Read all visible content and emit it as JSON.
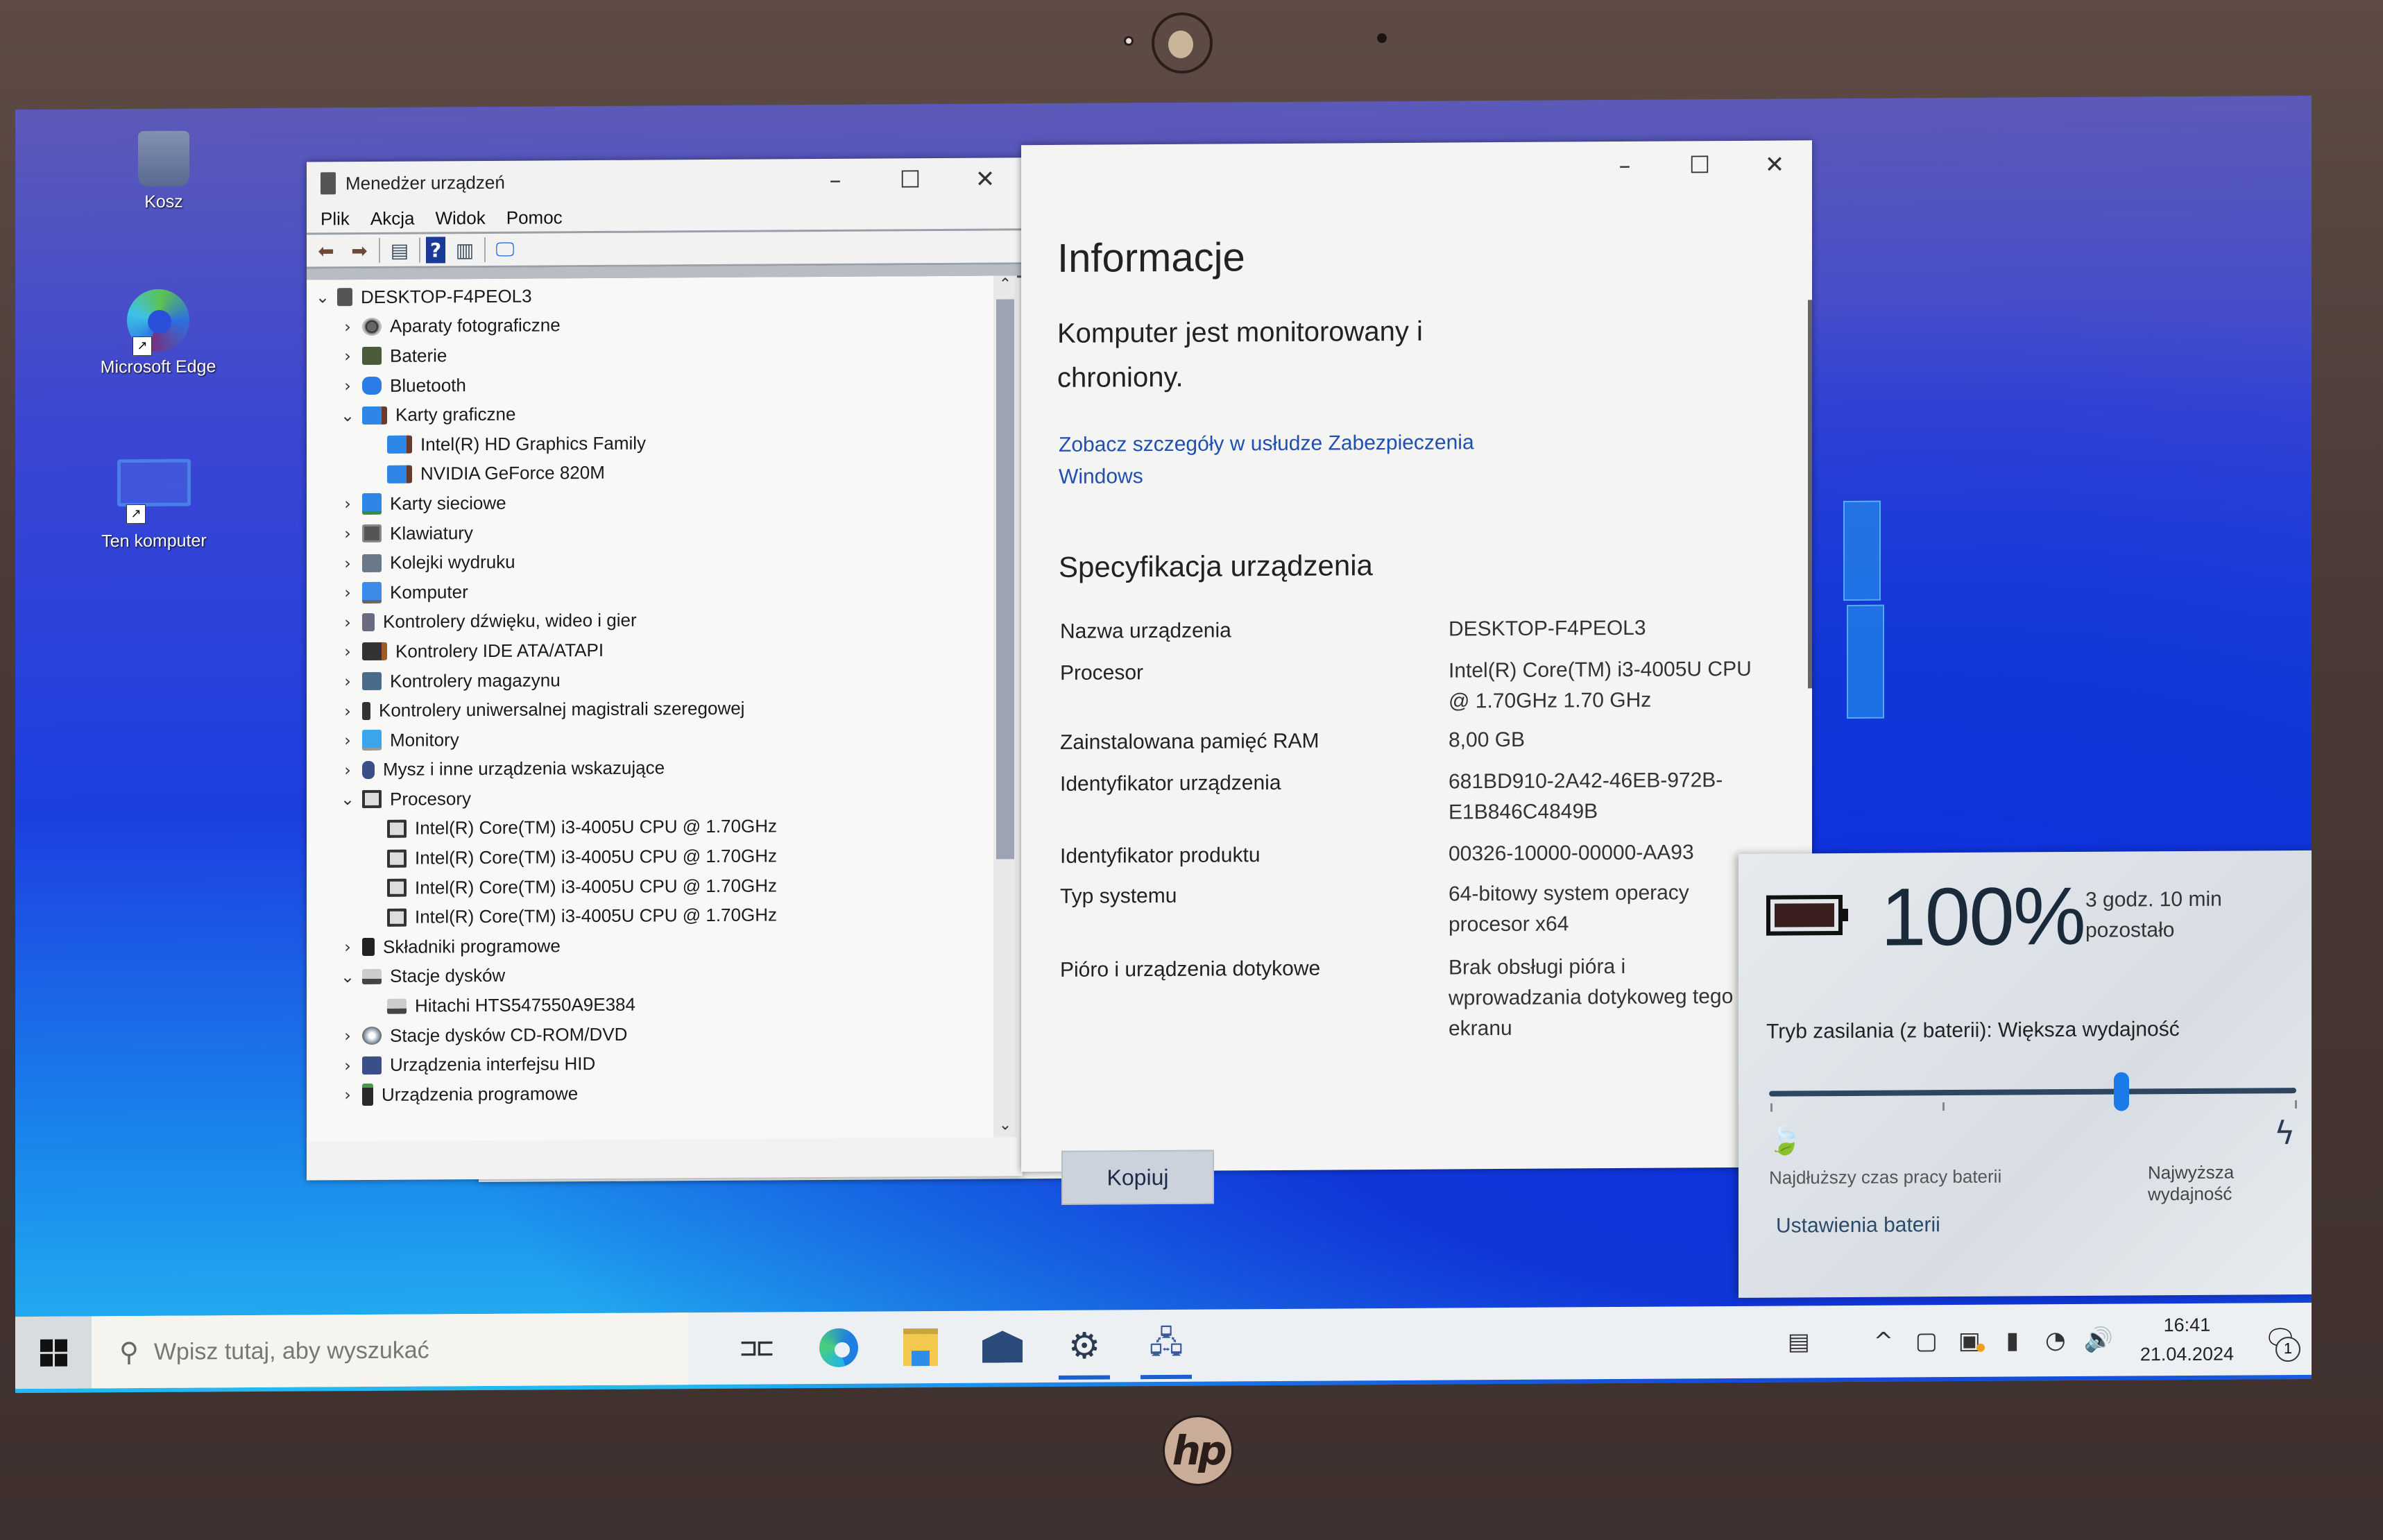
{
  "desktop": {
    "icons": [
      {
        "label": "Kosz",
        "icon": "recycle-bin-icon"
      },
      {
        "label": "Microsoft Edge",
        "icon": "edge-icon"
      },
      {
        "label": "Ten komputer",
        "icon": "computer-icon"
      }
    ]
  },
  "device_manager": {
    "title": "Menedżer urządzeń",
    "window_controls": {
      "minimize": "–",
      "maximize": "☐",
      "close": "✕"
    },
    "menu": [
      "Plik",
      "Akcja",
      "Widok",
      "Pomoc"
    ],
    "toolbar": [
      {
        "icon": "back-arrow-icon",
        "glyph": "⬅"
      },
      {
        "icon": "forward-arrow-icon",
        "glyph": "➡"
      },
      {
        "icon": "properties-icon",
        "glyph": "▤"
      },
      {
        "icon": "help-icon",
        "glyph": "?"
      },
      {
        "icon": "update-driver-icon",
        "glyph": "▥"
      },
      {
        "icon": "scan-hardware-icon",
        "glyph": "🖵"
      }
    ],
    "tree": [
      {
        "level": 0,
        "expander": "v",
        "icon": "root",
        "label": "DESKTOP-F4PEOL3"
      },
      {
        "level": 1,
        "expander": ">",
        "icon": "cam",
        "label": "Aparaty fotograficzne"
      },
      {
        "level": 1,
        "expander": ">",
        "icon": "bat",
        "label": "Baterie"
      },
      {
        "level": 1,
        "expander": ">",
        "icon": "bt",
        "label": "Bluetooth"
      },
      {
        "level": 1,
        "expander": "v",
        "icon": "gpu",
        "label": "Karty graficzne"
      },
      {
        "level": 2,
        "expander": "",
        "icon": "gpu",
        "label": "Intel(R) HD Graphics Family"
      },
      {
        "level": 2,
        "expander": "",
        "icon": "gpu",
        "label": "NVIDIA GeForce 820M"
      },
      {
        "level": 1,
        "expander": ">",
        "icon": "net",
        "label": "Karty sieciowe"
      },
      {
        "level": 1,
        "expander": ">",
        "icon": "kb",
        "label": "Klawiatury"
      },
      {
        "level": 1,
        "expander": ">",
        "icon": "print",
        "label": "Kolejki wydruku"
      },
      {
        "level": 1,
        "expander": ">",
        "icon": "pc",
        "label": "Komputer"
      },
      {
        "level": 1,
        "expander": ">",
        "icon": "snd",
        "label": "Kontrolery dźwięku, wideo i gier"
      },
      {
        "level": 1,
        "expander": ">",
        "icon": "ide",
        "label": "Kontrolery IDE ATA/ATAPI"
      },
      {
        "level": 1,
        "expander": ">",
        "icon": "stor",
        "label": "Kontrolery magazynu"
      },
      {
        "level": 1,
        "expander": ">",
        "icon": "usb",
        "label": "Kontrolery uniwersalnej magistrali szeregowej"
      },
      {
        "level": 1,
        "expander": ">",
        "icon": "mon",
        "label": "Monitory"
      },
      {
        "level": 1,
        "expander": ">",
        "icon": "mouse",
        "label": "Mysz i inne urządzenia wskazujące"
      },
      {
        "level": 1,
        "expander": "v",
        "icon": "cpu",
        "label": "Procesory"
      },
      {
        "level": 2,
        "expander": "",
        "icon": "cpu",
        "label": "Intel(R) Core(TM) i3-4005U CPU @ 1.70GHz"
      },
      {
        "level": 2,
        "expander": "",
        "icon": "cpu",
        "label": "Intel(R) Core(TM) i3-4005U CPU @ 1.70GHz"
      },
      {
        "level": 2,
        "expander": "",
        "icon": "cpu",
        "label": "Intel(R) Core(TM) i3-4005U CPU @ 1.70GHz"
      },
      {
        "level": 2,
        "expander": "",
        "icon": "cpu",
        "label": "Intel(R) Core(TM) i3-4005U CPU @ 1.70GHz"
      },
      {
        "level": 1,
        "expander": ">",
        "icon": "sw",
        "label": "Składniki programowe"
      },
      {
        "level": 1,
        "expander": "v",
        "icon": "disk",
        "label": "Stacje dysków"
      },
      {
        "level": 2,
        "expander": "",
        "icon": "disk",
        "label": "Hitachi HTS547550A9E384"
      },
      {
        "level": 1,
        "expander": ">",
        "icon": "cd",
        "label": "Stacje dysków CD-ROM/DVD"
      },
      {
        "level": 1,
        "expander": ">",
        "icon": "hid",
        "label": "Urządzenia interfejsu HID"
      },
      {
        "level": 1,
        "expander": ">",
        "icon": "prog",
        "label": "Urządzenia programowe"
      }
    ],
    "scroll": {
      "up": "⌃",
      "down": "⌄"
    }
  },
  "about": {
    "window_controls": {
      "minimize": "–",
      "maximize": "☐",
      "close": "✕"
    },
    "title": "Informacje",
    "status": "Komputer jest monitorowany i chroniony.",
    "security_link": "Zobacz szczegóły w usłudze Zabezpieczenia Windows",
    "spec_heading": "Specyfikacja urządzenia",
    "specs": [
      {
        "key": "Nazwa urządzenia",
        "value": "DESKTOP-F4PEOL3"
      },
      {
        "key": "Procesor",
        "value": "Intel(R) Core(TM) i3-4005U CPU @ 1.70GHz   1.70 GHz"
      },
      {
        "key": "Zainstalowana pamięć RAM",
        "value": "8,00 GB"
      },
      {
        "key": "Identyfikator urządzenia",
        "value": "681BD910-2A42-46EB-972B-E1B846C4849B"
      },
      {
        "key": "Identyfikator produktu",
        "value": "00326-10000-00000-AA93"
      },
      {
        "key": "Typ systemu",
        "value": "64-bitowy system operacy procesor x64"
      },
      {
        "key": "Pióro i urządzenia dotykowe",
        "value": "Brak obsługi pióra i wprowadzania dotykoweg tego ekranu"
      }
    ],
    "copy_button": "Kopiuj"
  },
  "battery_flyout": {
    "percent": "100%",
    "charge_fraction": 1.0,
    "time_remaining": "3 godz. 10 min pozostało",
    "power_mode": "Tryb zasilania (z baterii): Większa wydajność",
    "slider_position": 0.67,
    "left_label": "Najdłuższy czas pracy baterii",
    "right_label": "Najwyższa wydajność",
    "leaf_glyph": "🍃",
    "bolt_glyph": "ϟ",
    "settings_link": "Ustawienia baterii"
  },
  "taskbar": {
    "search_placeholder": "Wpisz tutaj, aby wyszukać",
    "search_glyph": "⚲",
    "task_view_glyph": "⊐⊏",
    "settings_glyph": "⚙",
    "devmgr_glyph": "🖧",
    "tray": {
      "news_glyph": "▤",
      "chevron_glyph": "^",
      "meet_glyph": "▢",
      "defender_glyph": "▣",
      "battery_glyph": "▮",
      "wifi_glyph": "◔",
      "volume_glyph": "🔊",
      "notification_glyph": "🗨",
      "notification_count": "1"
    },
    "time": "16:41",
    "date": "21.04.2024",
    "accent": "#1a5fd0"
  }
}
